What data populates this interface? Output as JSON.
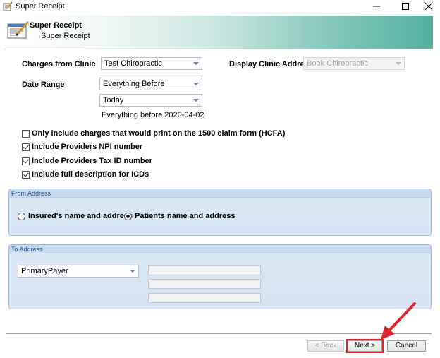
{
  "window": {
    "title": "Super Receipt",
    "controls": {
      "minimize": "—",
      "maximize": "☐",
      "close": "✕"
    }
  },
  "banner": {
    "title": "Super Receipt",
    "subtitle": "Super Receipt",
    "icon": "receipt-pencil-icon"
  },
  "form": {
    "charges_from_clinic": {
      "label": "Charges from Clinic",
      "value": "Test Chiropractic"
    },
    "display_clinic_address": {
      "label": "Display Clinic Address:",
      "value": "Book Chiropractic",
      "enabled": false
    },
    "date_range": {
      "label": "Date Range",
      "mode": "Everything Before",
      "date": "Today",
      "summary": "Everything before 2020-04-02"
    },
    "checkboxes": [
      {
        "label": "Only include charges that would print on the 1500 claim form (HCFA)",
        "checked": false
      },
      {
        "label": "Include Providers NPI number",
        "checked": true
      },
      {
        "label": "Include Providers Tax ID number",
        "checked": true
      },
      {
        "label": "Include full description for ICDs",
        "checked": true
      }
    ]
  },
  "from_address": {
    "header": "From Address",
    "options": [
      {
        "label": "Insured's name and address",
        "selected": false
      },
      {
        "label": "Patients name and address",
        "selected": true
      }
    ]
  },
  "to_address": {
    "header": "To Address",
    "payer": "PrimaryPayer",
    "lines": [
      "",
      "",
      ""
    ]
  },
  "buttons": {
    "back": "< Back",
    "next": "Next >",
    "cancel": "Cancel"
  },
  "colors": {
    "highlight": "#e0262b",
    "banner_accent": "#52b0a0",
    "group_bg": "#d6e4f3"
  }
}
